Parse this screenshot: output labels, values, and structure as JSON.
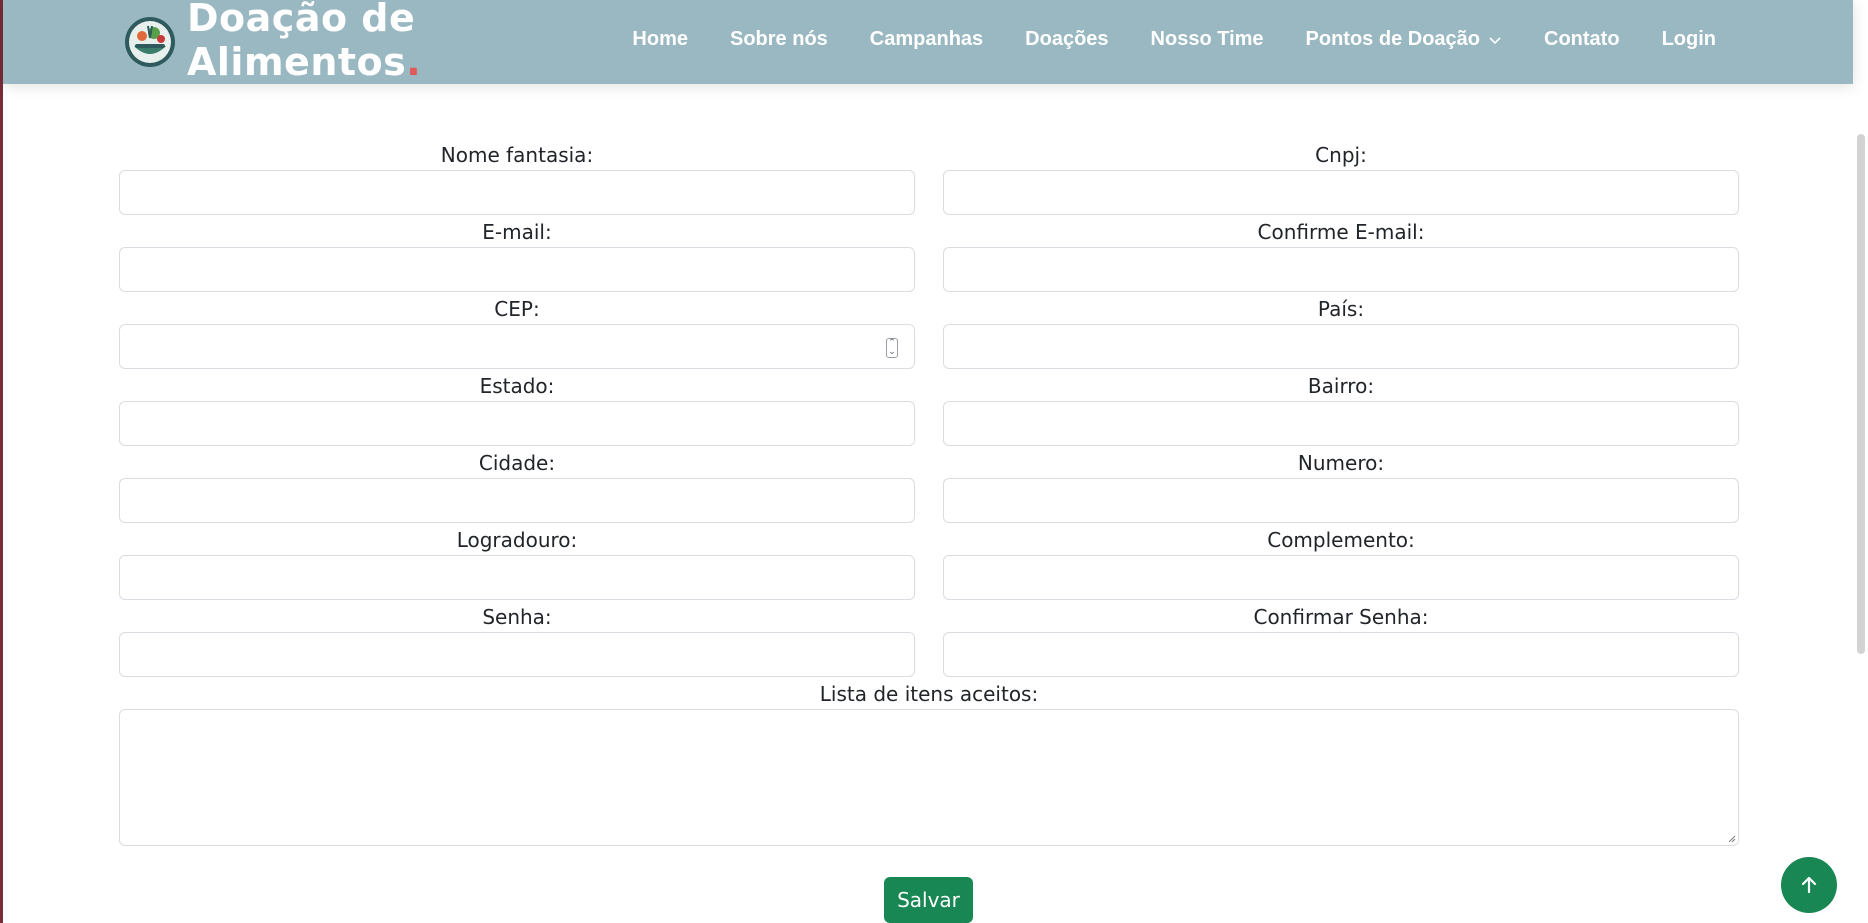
{
  "header": {
    "brand_line1": "Doação de",
    "brand_line2": "Alimentos",
    "brand_dot": ".",
    "logo_icon": "food-basket-logo-icon",
    "nav": [
      {
        "label": "Home"
      },
      {
        "label": "Sobre nós"
      },
      {
        "label": "Campanhas"
      },
      {
        "label": "Doações"
      },
      {
        "label": "Nosso Time"
      },
      {
        "label": "Pontos de Doação",
        "dropdown": true
      },
      {
        "label": "Contato"
      },
      {
        "label": "Login"
      }
    ]
  },
  "form": {
    "rows": [
      [
        {
          "label": "Nome fantasia:",
          "value": ""
        },
        {
          "label": "Cnpj:",
          "value": ""
        }
      ],
      [
        {
          "label": "E-mail:",
          "value": ""
        },
        {
          "label": "Confirme E-mail:",
          "value": ""
        }
      ],
      [
        {
          "label": "CEP:",
          "value": "",
          "type": "number"
        },
        {
          "label": "País:",
          "value": ""
        }
      ],
      [
        {
          "label": "Estado:",
          "value": ""
        },
        {
          "label": "Bairro:",
          "value": ""
        }
      ],
      [
        {
          "label": "Cidade:",
          "value": ""
        },
        {
          "label": "Numero:",
          "value": ""
        }
      ],
      [
        {
          "label": "Logradouro:",
          "value": ""
        },
        {
          "label": "Complemento:",
          "value": ""
        }
      ],
      [
        {
          "label": "Senha:",
          "value": ""
        },
        {
          "label": "Confirmar Senha:",
          "value": ""
        }
      ]
    ],
    "items_label": "Lista de itens aceitos:",
    "items_value": "",
    "save_label": "Salvar"
  },
  "icons": {
    "back_to_top": "arrow-up-icon",
    "dropdown": "chevron-down-icon"
  },
  "colors": {
    "header_bg": "#9ab8c1",
    "primary_green": "#198754",
    "brand_dot": "#e15a5a"
  }
}
